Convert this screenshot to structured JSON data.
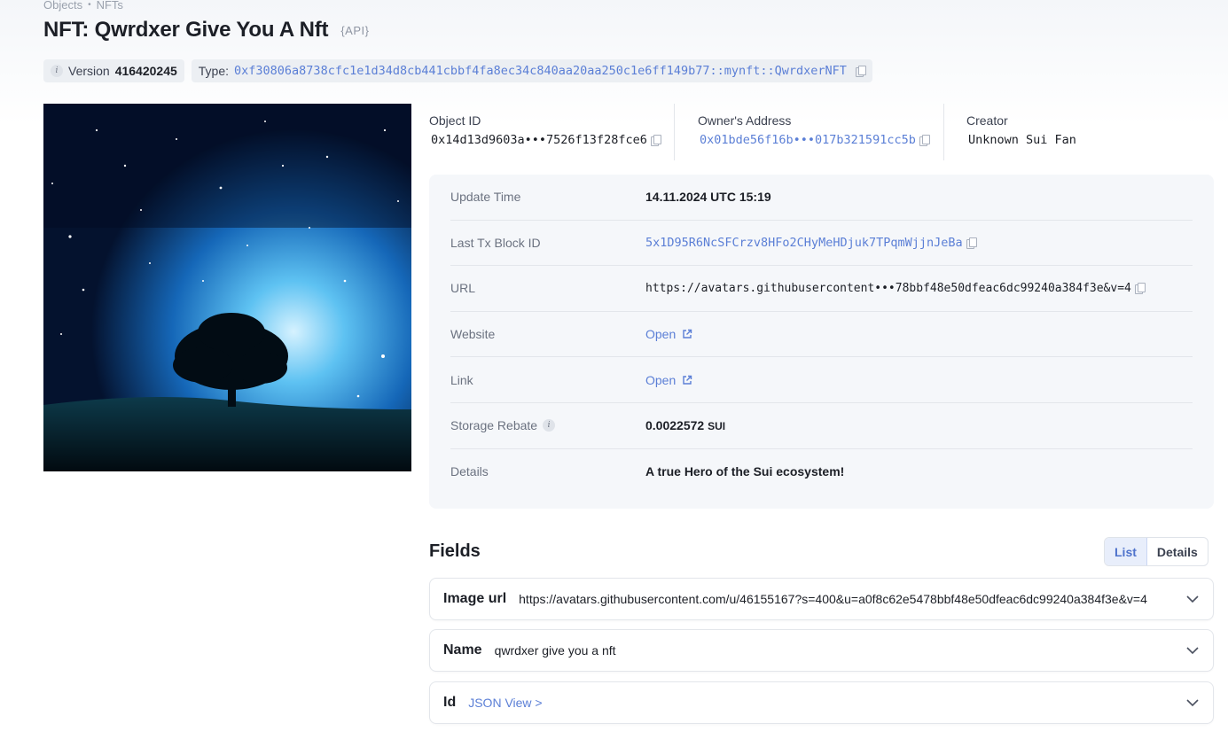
{
  "breadcrumb": {
    "item1": "Objects",
    "separator": "•",
    "item2": "NFTs"
  },
  "title": "NFT: Qwrdxer Give You A Nft",
  "api_badge": "{API}",
  "version": {
    "label": "Version",
    "value": "416420245"
  },
  "type": {
    "label": "Type:",
    "value": "0xf30806a8738cfc1e1d34d8cb441cbbf4fa8ec34c840aa20aa250c1e6ff149b77::mynft::QwrdxerNFT"
  },
  "object_id": {
    "label": "Object ID",
    "value": "0x14d13d9603a•••7526f13f28fce6"
  },
  "owner": {
    "label": "Owner's Address",
    "value": "0x01bde56f16b•••017b321591cc5b"
  },
  "creator": {
    "label": "Creator",
    "value": "Unknown Sui Fan"
  },
  "details": {
    "update_time": {
      "label": "Update Time",
      "value": "14.11.2024 UTC 15:19"
    },
    "last_tx": {
      "label": "Last Tx Block ID",
      "value": "5x1D95R6NcSFCrzv8HFo2CHyMeHDjuk7TPqmWjjnJeBa"
    },
    "url": {
      "label": "URL",
      "value": "https://avatars.githubusercontent•••78bbf48e50dfeac6dc99240a384f3e&v=4"
    },
    "website": {
      "label": "Website",
      "value": "Open"
    },
    "link": {
      "label": "Link",
      "value": "Open"
    },
    "storage_rebate": {
      "label": "Storage Rebate",
      "value": "0.0022572",
      "unit": "SUI"
    },
    "description": {
      "label": "Details",
      "value": "A true Hero of the Sui ecosystem!"
    }
  },
  "fields": {
    "title": "Fields",
    "toggle_list": "List",
    "toggle_details": "Details",
    "items": [
      {
        "name": "Image url",
        "value": "https://avatars.githubusercontent.com/u/46155167?s=400&u=a0f8c62e5478bbf48e50dfeac6dc99240a384f3e&v=4"
      },
      {
        "name": "Name",
        "value": "qwrdxer give you a nft"
      },
      {
        "name": "Id",
        "value": "JSON View >"
      }
    ]
  },
  "colors": {
    "accent": "#5b7fd6",
    "card_bg": "#f5f7fa",
    "text": "#1c1f26",
    "muted": "#6b7280"
  }
}
